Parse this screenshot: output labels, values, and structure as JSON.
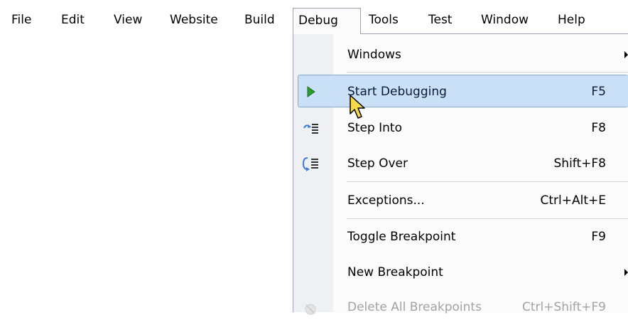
{
  "menubar": {
    "items": [
      {
        "label": "File"
      },
      {
        "label": "Edit"
      },
      {
        "label": "View"
      },
      {
        "label": "Website"
      },
      {
        "label": "Build"
      },
      {
        "label": "Debug"
      },
      {
        "label": "Tools"
      },
      {
        "label": "Test"
      },
      {
        "label": "Window"
      },
      {
        "label": "Help"
      }
    ],
    "open_item": "Debug"
  },
  "debug_menu": {
    "items": [
      {
        "label": "Windows",
        "shortcut": "",
        "submenu": true,
        "icon": ""
      },
      {
        "label": "Start Debugging",
        "shortcut": "F5",
        "submenu": false,
        "icon": "play-icon",
        "highlighted": true
      },
      {
        "label": "Step Into",
        "shortcut": "F8",
        "submenu": false,
        "icon": "step-into-icon"
      },
      {
        "label": "Step Over",
        "shortcut": "Shift+F8",
        "submenu": false,
        "icon": "step-over-icon"
      },
      {
        "label": "Exceptions...",
        "shortcut": "Ctrl+Alt+E",
        "submenu": false,
        "icon": ""
      },
      {
        "label": "Toggle Breakpoint",
        "shortcut": "F9",
        "submenu": false,
        "icon": ""
      },
      {
        "label": "New Breakpoint",
        "shortcut": "",
        "submenu": true,
        "icon": ""
      },
      {
        "label": "Delete All Breakpoints",
        "shortcut": "Ctrl+Shift+F9",
        "submenu": false,
        "icon": "delete-breakpoints-icon",
        "disabled": true
      }
    ]
  },
  "colors": {
    "highlight_fill": "#c9e0f7",
    "highlight_border": "#7fa9d8",
    "gutter": "#eef0f3",
    "disabled_text": "#a3a3a3"
  }
}
